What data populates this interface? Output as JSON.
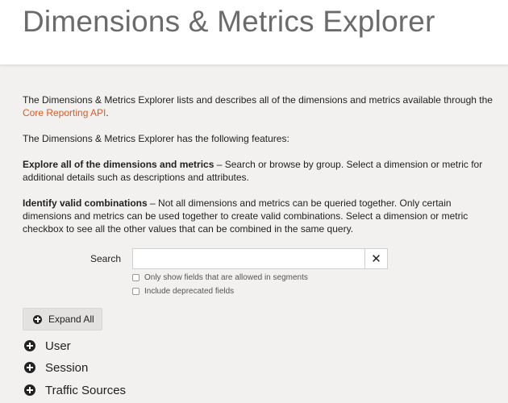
{
  "header": {
    "title": "Dimensions & Metrics Explorer"
  },
  "intro": {
    "p1_text": "The Dimensions & Metrics Explorer lists and describes all of the dimensions and metrics available through the",
    "p1_link": "Core Reporting API",
    "p1_end": ".",
    "p2": "The Dimensions & Metrics Explorer has the following features:",
    "p3_bold": "Explore all of the dimensions and metrics",
    "p3_rest": " – Search or browse by group. Select a dimension or metric for additional details such as descriptions and attributes.",
    "p4_bold": "Identify valid combinations",
    "p4_rest": " – Not all dimensions and metrics can be queried together. Only certain dimensions and metrics can be used together to create valid combinations. Select a dimension or metric checkbox to see all the other values that can be combined in the same query."
  },
  "search": {
    "label": "Search",
    "value": "",
    "placeholder": "",
    "clear_icon": "close-icon",
    "clear_glyph": "✕"
  },
  "options": [
    {
      "label": "Only show fields that are allowed in segments",
      "checked": false
    },
    {
      "label": "Include deprecated fields",
      "checked": false
    }
  ],
  "expand_all": {
    "label": "Expand All",
    "icon": "plus-circle-icon"
  },
  "groups": [
    {
      "label": "User",
      "icon": "plus-circle-icon"
    },
    {
      "label": "Session",
      "icon": "plus-circle-icon"
    },
    {
      "label": "Traffic Sources",
      "icon": "plus-circle-icon"
    }
  ],
  "colors": {
    "link": "#dd5a26",
    "background": "#f2f1f0",
    "header_bg": "#ffffff",
    "title": "#6b6b6b"
  }
}
